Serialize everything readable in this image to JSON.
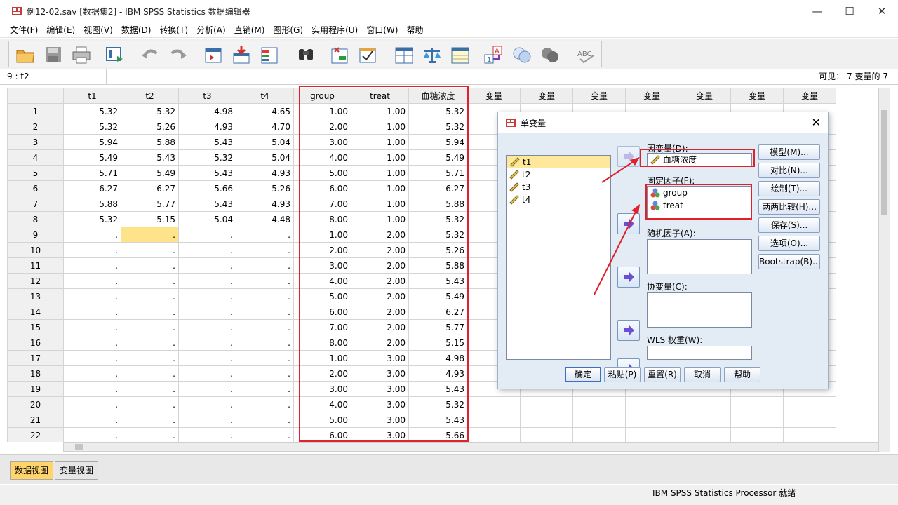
{
  "window": {
    "title": "例12-02.sav [数据集2] - IBM SPSS Statistics 数据编辑器",
    "minimize": "—",
    "maximize": "☐",
    "close": "✕"
  },
  "menubar": [
    "文件(F)",
    "编辑(E)",
    "视图(V)",
    "数据(D)",
    "转换(T)",
    "分析(A)",
    "直销(M)",
    "图形(G)",
    "实用程序(U)",
    "窗口(W)",
    "帮助"
  ],
  "refbar": {
    "cell": "9 : t2",
    "visible": "可见： 7 变量的 7"
  },
  "grid": {
    "columns": [
      "t1",
      "t2",
      "t3",
      "t4",
      "group",
      "treat",
      "血糖浓度",
      "变量",
      "变量",
      "变量",
      "变量",
      "变量",
      "变量",
      "变量"
    ],
    "rows": [
      {
        "n": "1",
        "c": [
          "5.32",
          "5.32",
          "4.98",
          "4.65",
          "1.00",
          "1.00",
          "5.32"
        ]
      },
      {
        "n": "2",
        "c": [
          "5.32",
          "5.26",
          "4.93",
          "4.70",
          "2.00",
          "1.00",
          "5.32"
        ]
      },
      {
        "n": "3",
        "c": [
          "5.94",
          "5.88",
          "5.43",
          "5.04",
          "3.00",
          "1.00",
          "5.94"
        ]
      },
      {
        "n": "4",
        "c": [
          "5.49",
          "5.43",
          "5.32",
          "5.04",
          "4.00",
          "1.00",
          "5.49"
        ]
      },
      {
        "n": "5",
        "c": [
          "5.71",
          "5.49",
          "5.43",
          "4.93",
          "5.00",
          "1.00",
          "5.71"
        ]
      },
      {
        "n": "6",
        "c": [
          "6.27",
          "6.27",
          "5.66",
          "5.26",
          "6.00",
          "1.00",
          "6.27"
        ]
      },
      {
        "n": "7",
        "c": [
          "5.88",
          "5.77",
          "5.43",
          "4.93",
          "7.00",
          "1.00",
          "5.88"
        ]
      },
      {
        "n": "8",
        "c": [
          "5.32",
          "5.15",
          "5.04",
          "4.48",
          "8.00",
          "1.00",
          "5.32"
        ]
      },
      {
        "n": "9",
        "c": [
          ".",
          ".",
          ".",
          ".",
          "1.00",
          "2.00",
          "5.32"
        ]
      },
      {
        "n": "10",
        "c": [
          ".",
          ".",
          ".",
          ".",
          "2.00",
          "2.00",
          "5.26"
        ]
      },
      {
        "n": "11",
        "c": [
          ".",
          ".",
          ".",
          ".",
          "3.00",
          "2.00",
          "5.88"
        ]
      },
      {
        "n": "12",
        "c": [
          ".",
          ".",
          ".",
          ".",
          "4.00",
          "2.00",
          "5.43"
        ]
      },
      {
        "n": "13",
        "c": [
          ".",
          ".",
          ".",
          ".",
          "5.00",
          "2.00",
          "5.49"
        ]
      },
      {
        "n": "14",
        "c": [
          ".",
          ".",
          ".",
          ".",
          "6.00",
          "2.00",
          "6.27"
        ]
      },
      {
        "n": "15",
        "c": [
          ".",
          ".",
          ".",
          ".",
          "7.00",
          "2.00",
          "5.77"
        ]
      },
      {
        "n": "16",
        "c": [
          ".",
          ".",
          ".",
          ".",
          "8.00",
          "2.00",
          "5.15"
        ]
      },
      {
        "n": "17",
        "c": [
          ".",
          ".",
          ".",
          ".",
          "1.00",
          "3.00",
          "4.98"
        ]
      },
      {
        "n": "18",
        "c": [
          ".",
          ".",
          ".",
          ".",
          "2.00",
          "3.00",
          "4.93"
        ]
      },
      {
        "n": "19",
        "c": [
          ".",
          ".",
          ".",
          ".",
          "3.00",
          "3.00",
          "5.43"
        ]
      },
      {
        "n": "20",
        "c": [
          ".",
          ".",
          ".",
          ".",
          "4.00",
          "3.00",
          "5.32"
        ]
      },
      {
        "n": "21",
        "c": [
          ".",
          ".",
          ".",
          ".",
          "5.00",
          "3.00",
          "5.43"
        ]
      },
      {
        "n": "22",
        "c": [
          ".",
          ".",
          ".",
          ".",
          "6.00",
          "3.00",
          "5.66"
        ]
      }
    ]
  },
  "tabs": {
    "data_view": "数据视图",
    "variable_view": "变量视图"
  },
  "status": "IBM SPSS Statistics Processor 就绪",
  "dialog": {
    "title": "单变量",
    "close": "✕",
    "source_vars": [
      "t1",
      "t2",
      "t3",
      "t4"
    ],
    "dependent_label": "因变量(D):",
    "dependent_value": "血糖浓度",
    "fixed_label": "固定因子(F):",
    "fixed_values": [
      "group",
      "treat"
    ],
    "random_label": "随机因子(A):",
    "covariate_label": "协变量(C):",
    "wls_label": "WLS 权重(W):",
    "side_buttons": [
      "模型(M)...",
      "对比(N)...",
      "绘制(T)...",
      "两两比较(H)...",
      "保存(S)...",
      "选项(O)...",
      "Bootstrap(B)..."
    ],
    "bottom_buttons": [
      "确定",
      "粘贴(P)",
      "重置(R)",
      "取消",
      "帮助"
    ]
  },
  "colors": {
    "highlight_red": "#e0202a",
    "selected_cell": "#ffe38a",
    "dialog_bg": "#e3ebf5",
    "arrow_purple": "#6a4fd0"
  },
  "icons": [
    "spss-app-icon",
    "open-icon",
    "save-icon",
    "print-icon",
    "dialog-recall-icon",
    "undo-icon",
    "redo-icon",
    "goto-case-icon",
    "goto-variable-icon",
    "variables-icon",
    "find-icon",
    "insert-cases-icon",
    "insert-variable-icon",
    "split-file-icon",
    "weight-cases-icon",
    "select-cases-icon",
    "value-labels-icon",
    "use-sets-icon",
    "show-all-icon",
    "spell-icon"
  ]
}
